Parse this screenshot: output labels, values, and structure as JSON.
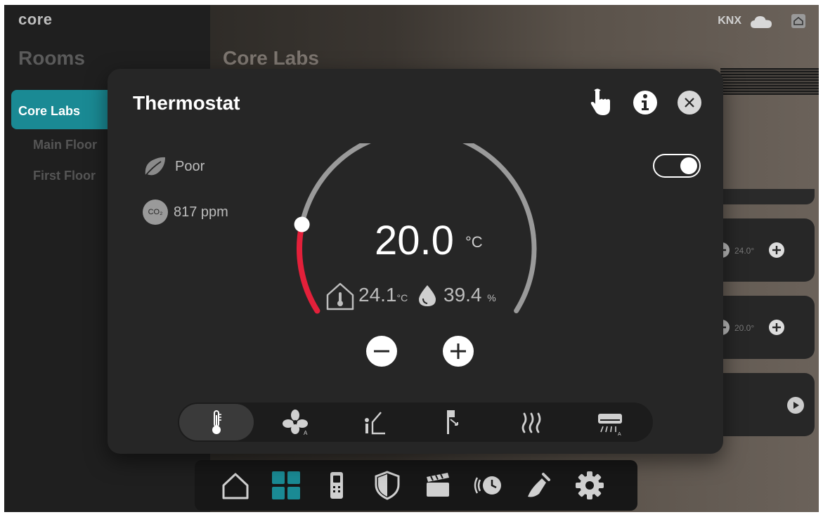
{
  "app": {
    "brand": "core"
  },
  "topbar": {
    "protocol": "KNX",
    "icons": [
      "cloud-icon",
      "home-icon"
    ]
  },
  "sidebar": {
    "title": "Rooms",
    "active_room": "Core Labs",
    "sub_rooms": [
      "Main Floor",
      "First Floor"
    ]
  },
  "main": {
    "room_title": "Core Labs",
    "side_cards": [
      {
        "value": "24.0°"
      },
      {
        "value": "20.0°"
      }
    ]
  },
  "thermostat": {
    "title": "Thermostat",
    "air_quality": {
      "label": "Poor",
      "icon": "leaf-icon"
    },
    "co2": {
      "badge": "CO₂",
      "value": "817 ppm"
    },
    "power_on": true,
    "setpoint": {
      "value": "20.0",
      "unit": "°C",
      "level": 0.18
    },
    "room_temp": {
      "value": "24.1",
      "unit": "°C"
    },
    "humidity": {
      "value": "39.4",
      "unit": "%"
    },
    "modes": [
      "thermometer-icon",
      "fan-auto-icon",
      "seat-icon",
      "flag-icon",
      "heat-waves-icon",
      "ac-unit-icon"
    ],
    "active_mode": 0
  },
  "dock": {
    "items": [
      "home-icon",
      "grid-icon",
      "intercom-icon",
      "shield-icon",
      "scene-icon",
      "schedule-icon",
      "cleaning-icon",
      "settings-icon"
    ]
  },
  "colors": {
    "accent": "#1a8a94",
    "arc_active": "#e3203a",
    "arc_track": "#9a9a9a"
  }
}
